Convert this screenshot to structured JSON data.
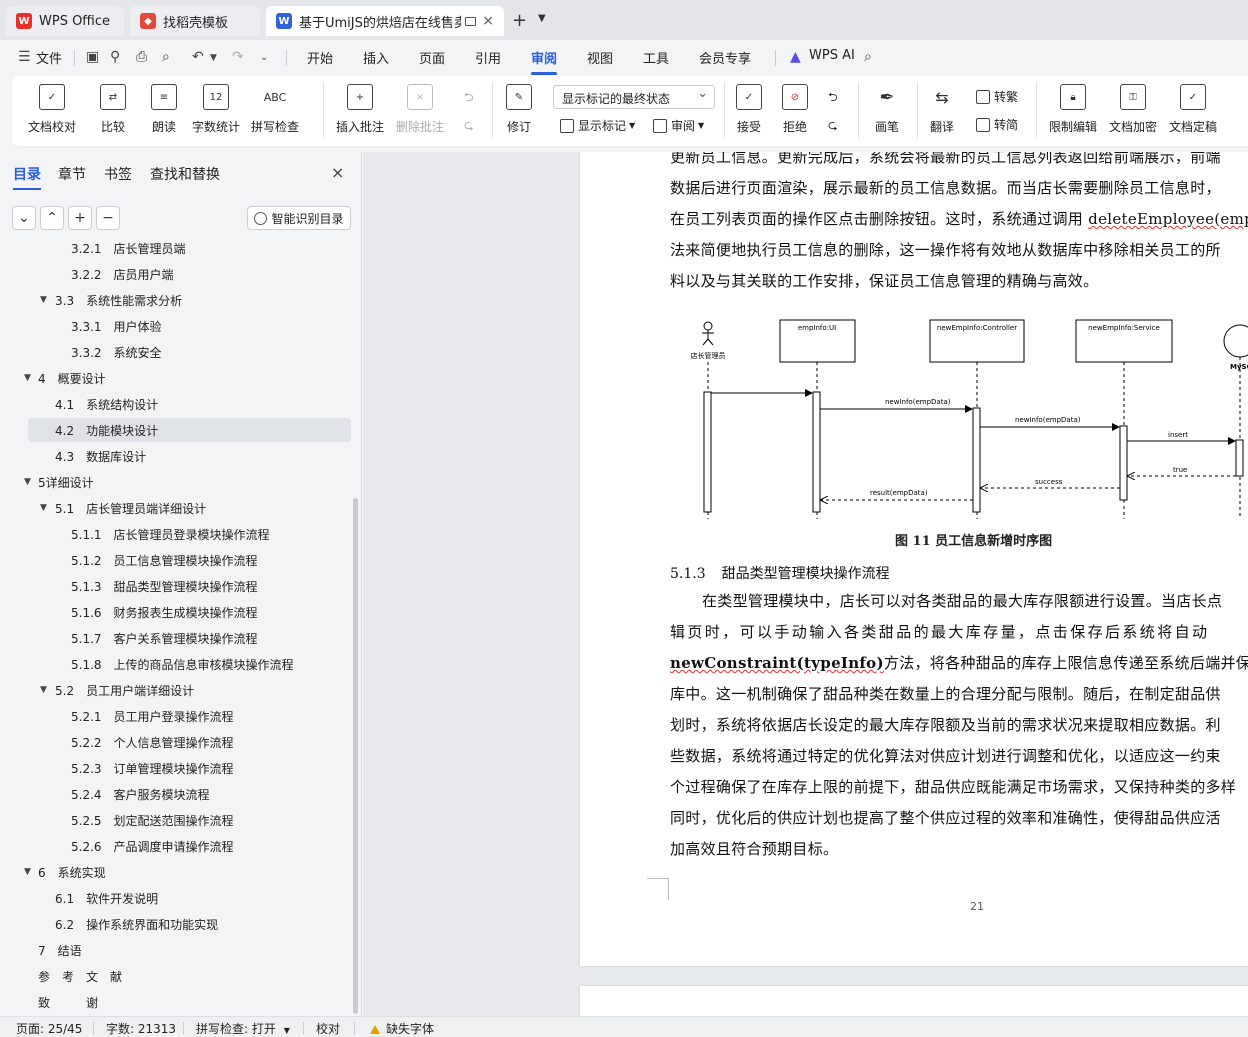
{
  "tabs": [
    {
      "label": "WPS Office",
      "icon": "wps-logo-icon"
    },
    {
      "label": "找稻壳模板",
      "icon": "docer-icon"
    },
    {
      "label": "基于UmiJS的烘焙店在线售卖",
      "icon": "word-doc-icon",
      "close": "×"
    }
  ],
  "tab_new": "+",
  "menu": {
    "file": "文件",
    "items": [
      "开始",
      "插入",
      "页面",
      "引用",
      "审阅",
      "视图",
      "工具",
      "会员专享"
    ],
    "active": "审阅",
    "ai": "WPS AI"
  },
  "ribbon": {
    "proofread": "文档校对",
    "compare": "比较",
    "read_aloud": "朗读",
    "word_count": "字数统计",
    "spell_check": "拼写检查",
    "insert_comment": "插入批注",
    "delete_comment": "删除批注",
    "revise": "修订",
    "markup_dropdown": "显示标记的最终状态",
    "show_markup": "显示标记",
    "review": "审阅",
    "accept": "接受",
    "reject": "拒绝",
    "pen": "画笔",
    "translate": "翻译",
    "to_traditional": "转繁",
    "to_simplified": "转简",
    "restrict_edit": "限制编辑",
    "encrypt": "文档加密",
    "finalize": "文档定稿"
  },
  "panel": {
    "tabs": [
      "目录",
      "章节",
      "书签",
      "查找和替换"
    ],
    "close": "×",
    "smart_btn": "智能识别目录",
    "toc": [
      {
        "text": "3.2.1　店长管理员端",
        "indent": 2
      },
      {
        "text": "3.2.2　店员用户端",
        "indent": 2
      },
      {
        "text": "3.3　系统性能需求分析",
        "indent": 1,
        "arrow": true
      },
      {
        "text": "3.3.1　用户体验",
        "indent": 2
      },
      {
        "text": "3.3.2　系统安全",
        "indent": 2
      },
      {
        "text": "4　概要设计",
        "indent": 0,
        "arrow": true
      },
      {
        "text": "4.1　系统结构设计",
        "indent": 1
      },
      {
        "text": "4.2　功能模块设计",
        "indent": 1,
        "selected": true
      },
      {
        "text": "4.3　数据库设计",
        "indent": 1
      },
      {
        "text": "5详细设计",
        "indent": 0,
        "arrow": true
      },
      {
        "text": "5.1　店长管理员端详细设计",
        "indent": 1,
        "arrow": true
      },
      {
        "text": "5.1.1　店长管理员登录模块操作流程",
        "indent": 2
      },
      {
        "text": "5.1.2　员工信息管理模块操作流程",
        "indent": 2
      },
      {
        "text": "5.1.3　甜品类型管理模块操作流程",
        "indent": 2
      },
      {
        "text": "5.1.6　财务报表生成模块操作流程",
        "indent": 2
      },
      {
        "text": "5.1.7　客户关系管理模块操作流程",
        "indent": 2
      },
      {
        "text": "5.1.8　上传的商品信息审核模块操作流程",
        "indent": 2
      },
      {
        "text": "5.2　员工用户端详细设计",
        "indent": 1,
        "arrow": true
      },
      {
        "text": "5.2.1　员工用户登录操作流程",
        "indent": 2
      },
      {
        "text": "5.2.2　个人信息管理操作流程",
        "indent": 2
      },
      {
        "text": "5.2.3　订单管理模块操作流程",
        "indent": 2
      },
      {
        "text": "5.2.4　客户服务模块流程",
        "indent": 2
      },
      {
        "text": "5.2.5　划定配送范围操作流程",
        "indent": 2
      },
      {
        "text": "5.2.6　产品调度申请操作流程",
        "indent": 2
      },
      {
        "text": "6　系统实现",
        "indent": 0,
        "arrow": true
      },
      {
        "text": "6.1　软件开发说明",
        "indent": 1
      },
      {
        "text": "6.2　操作系统界面和功能实现",
        "indent": 1
      },
      {
        "text": "7　结语",
        "indent": 0
      },
      {
        "text": "参　考　文　献",
        "indent": 0
      },
      {
        "text": "致　　　谢",
        "indent": 0
      }
    ]
  },
  "document": {
    "para1": [
      "更新员工信息。更新完成后，系统会将最新的员工信息列表返回给前端展示，前端",
      "数据后进行页面渲染，展示最新的员工信息数据。而当店长需要删除员工信息时，",
      "在员工列表页面的操作区点击删除按钮。这时，系统通过调用 ",
      "法来简便地执行员工信息的删除，这一操作将有效地从数据库中移除相关员工的所",
      "料以及与其关联的工作安排，保证员工信息管理的精确与高效。"
    ],
    "para1_code": "deleteEmployee(empIc",
    "diagram": {
      "actor": "店长管理员",
      "lifelines": [
        "empInfo:UI",
        "newEmpInfo:Controller",
        "newEmpInfo:Service",
        "MySQ"
      ],
      "messages": [
        "newInfo(empData)",
        "newInfo(empData)",
        "insert",
        "true",
        "success",
        "result(empData)"
      ]
    },
    "caption": "图 11  员工信息新增时序图",
    "heading_num": "5.1.3",
    "heading_text": "甜品类型管理模块操作流程",
    "para2": [
      "在类型管理模块中，店长可以对各类甜品的最大库存限额进行设置。当店长点",
      "辑页时，可以手动输入各类甜品的最大库存量，点击保存后系统将自动",
      "方法，将各种甜品的库存上限信息传递至系统后端并保存在",
      "库中。这一机制确保了甜品种类在数量上的合理分配与限制。随后，在制定甜品供",
      "划时，系统将依据店长设定的最大库存限额及当前的需求状况来提取相应数据。利",
      "些数据，系统将通过特定的优化算法对供应计划进行调整和优化，以适应这一约束",
      "个过程确保了在库存上限的前提下，甜品供应既能满足市场需求，又保持种类的多样",
      "同时，优化后的供应计划也提高了整个供应过程的效率和准确性，使得甜品供应活",
      "加高效且符合预期目标。"
    ],
    "para2_code": "newConstraint(typeInfo)",
    "page_number": "21"
  },
  "status": {
    "page": "页面: 25/45",
    "words": "字数: 21313",
    "spell": "拼写检查: 打开",
    "proof": "校对",
    "missing_font": "缺失字体"
  },
  "colors": {
    "accent": "#2b5fd9",
    "wps_red": "#e8312f",
    "docer_red": "#e5483b",
    "word_blue": "#2f64d8"
  }
}
